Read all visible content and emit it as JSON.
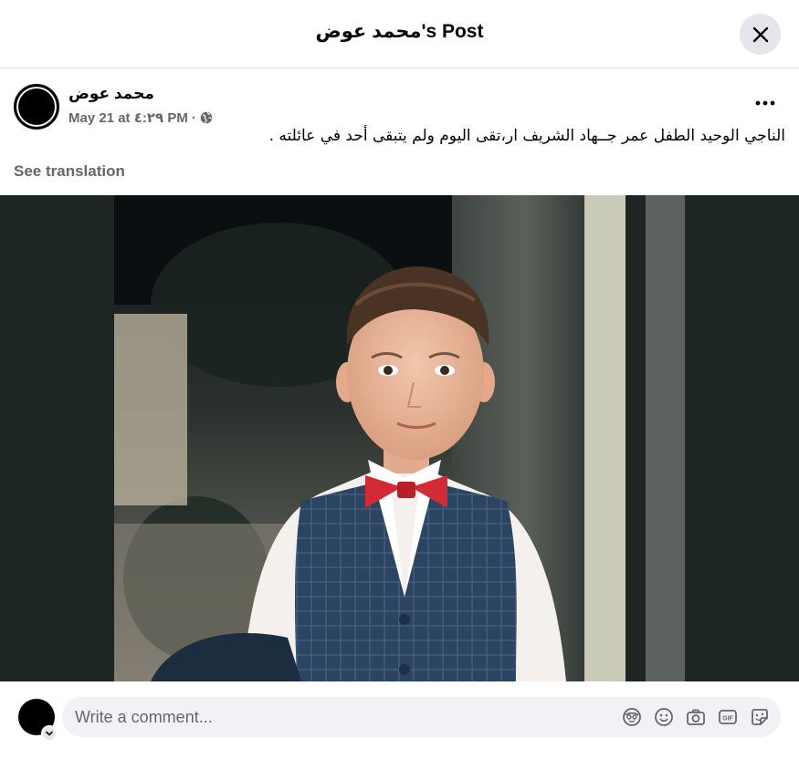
{
  "header": {
    "title": "محمد عوض's Post"
  },
  "post": {
    "author": "محمد عوض",
    "date": "May 21 at ٤:٢٩ PM",
    "separator": "·",
    "text": "الناجي الوحيد الطفل عمر جــهاد الشريف ار،تقى اليوم ولم يتبقى أحد في عائلته .",
    "see_translation": "See translation"
  },
  "composer": {
    "placeholder": "Write a comment..."
  },
  "icons": {
    "close": "close-icon",
    "more": "more-options-icon",
    "globe": "globe-icon",
    "avatar_sticker": "avatar-sticker-icon",
    "emoji": "emoji-icon",
    "camera": "camera-icon",
    "gif": "gif-icon",
    "sticker": "sticker-icon"
  },
  "colors": {
    "secondary_text": "#65676b",
    "input_bg": "#f0f2f5",
    "button_bg": "#e4e6eb",
    "media_bg": "#1e2624"
  }
}
